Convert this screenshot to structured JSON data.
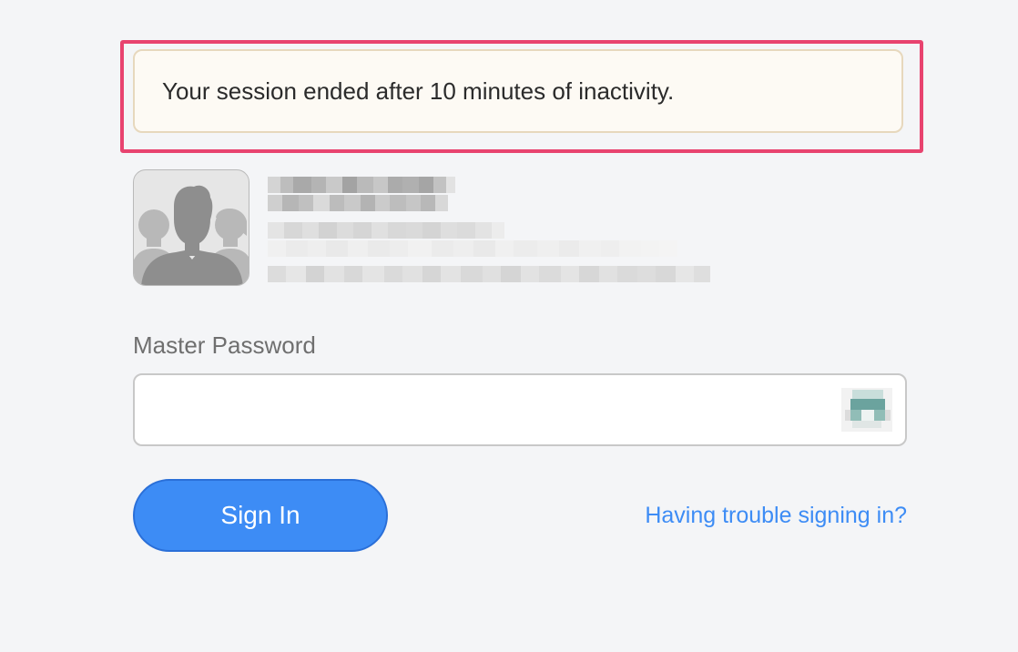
{
  "banner": {
    "message": "Your session ended after 10 minutes of inactivity."
  },
  "account": {
    "avatar_icon": "user-group-icon"
  },
  "login": {
    "password_label": "Master Password",
    "password_value": "",
    "password_field_icon": "password-manager-icon",
    "sign_in_label": "Sign In",
    "trouble_link": "Having trouble signing in?"
  },
  "colors": {
    "background": "#f4f5f7",
    "highlight_border": "#e8436f",
    "banner_background": "#fdfaf4",
    "banner_border": "#e7d8bd",
    "accent": "#3d8cf5"
  }
}
